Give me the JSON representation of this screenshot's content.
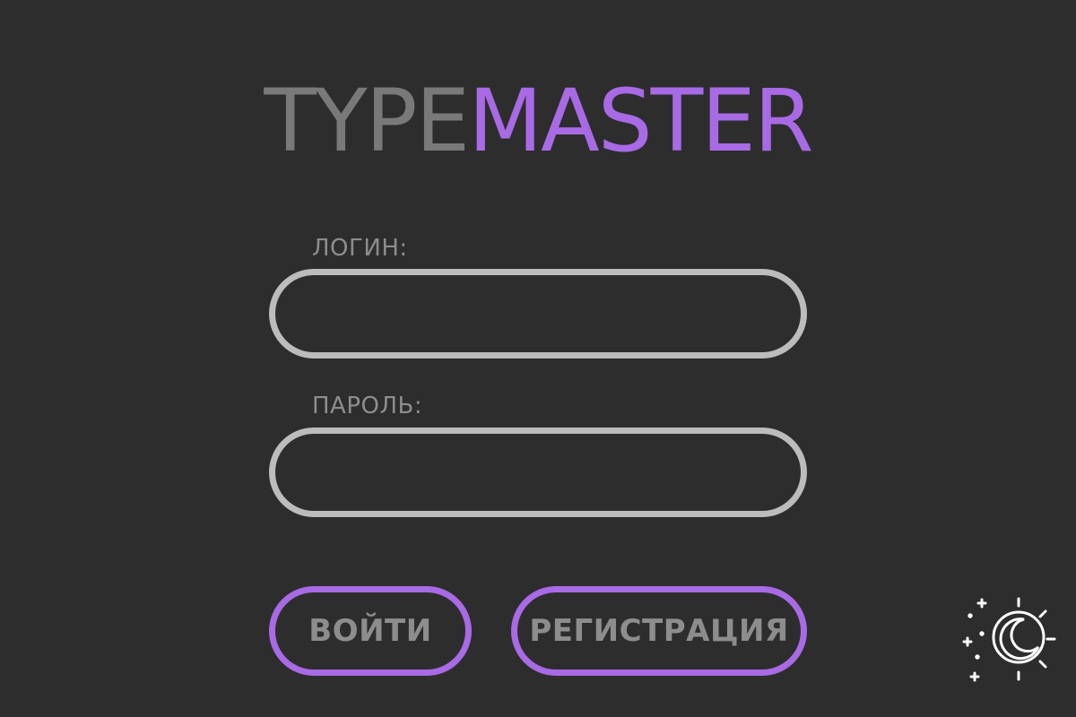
{
  "app": {
    "logo_part1": "TYPE",
    "logo_part2": "MASTER"
  },
  "form": {
    "login_label": "ЛОГИН:",
    "login_value": "",
    "password_label": "ПАРОЛЬ:",
    "password_value": ""
  },
  "actions": {
    "login_button": "ВОЙТИ",
    "register_button": "РЕГИСТРАЦИЯ"
  },
  "theme": {
    "toggle_icon": "moon-sun-icon"
  },
  "colors": {
    "background": "#2e2d2e",
    "accent": "#a86ae5",
    "muted_text": "#8e8d8e",
    "logo_gray": "#7a797a",
    "input_border": "#bdbcbd",
    "icon": "#ffffff"
  }
}
